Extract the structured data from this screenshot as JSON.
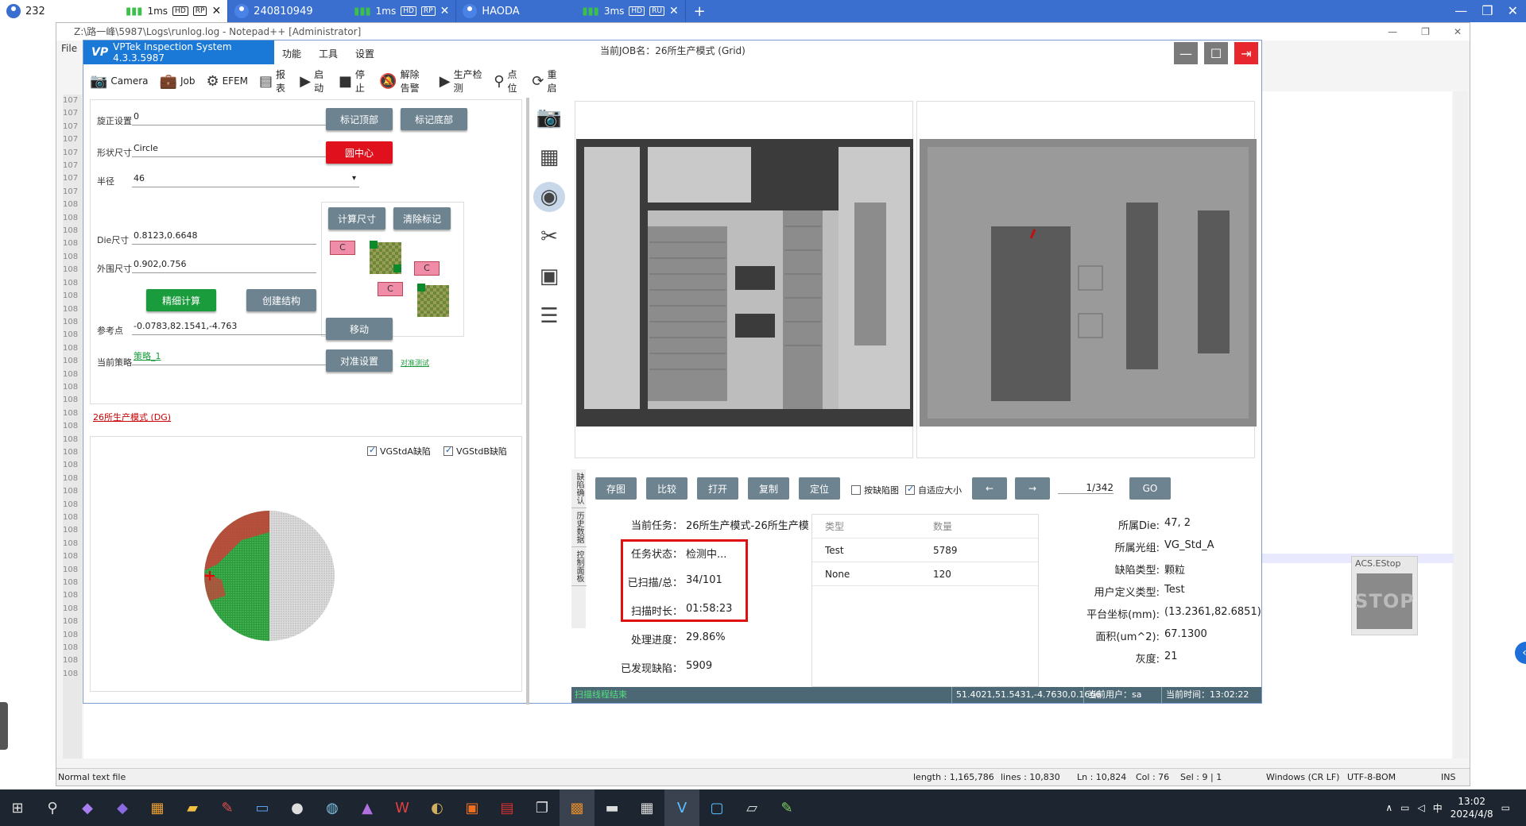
{
  "remote_tabs": [
    {
      "name": "232",
      "signal": "1ms",
      "badge1": "HD",
      "badge2": "RP",
      "active": true
    },
    {
      "name": "240810949",
      "signal": "1ms",
      "badge1": "HD",
      "badge2": "RP",
      "active": false
    },
    {
      "name": "HAODA",
      "signal": "3ms",
      "badge1": "HD",
      "badge2": "RU",
      "active": false
    }
  ],
  "notepad": {
    "title": "Z:\\路一峰\\5987\\Logs\\runlog.log - Notepad++ [Administrator]",
    "menu": "File",
    "line_numbers": [
      "107",
      "107",
      "107",
      "107",
      "107",
      "107",
      "107",
      "107",
      "108",
      "108",
      "108",
      "108",
      "108",
      "108",
      "108",
      "108",
      "108",
      "108",
      "108",
      "108",
      "108",
      "108",
      "108",
      "108",
      "108",
      "108",
      "108",
      "108",
      "108",
      "108",
      "108",
      "108",
      "108",
      "108",
      "108",
      "108",
      "108",
      "108",
      "108",
      "108",
      "108",
      "108",
      "108",
      "108",
      "108"
    ],
    "status": {
      "file_type": "Normal text file",
      "length": "length : 1,165,786",
      "lines": "lines : 10,830",
      "ln": "Ln : 10,824",
      "col": "Col : 76",
      "sel": "Sel : 9 | 1",
      "eol": "Windows (CR LF)",
      "encoding": "UTF-8-BOM",
      "mode": "INS"
    }
  },
  "app": {
    "title": "VPTek Inspection System 4.3.3.5987",
    "logo": "VP",
    "menu": [
      "功能",
      "工具",
      "设置"
    ],
    "current_job": "当前JOB名：26所生产模式 (Grid)",
    "toolbar": [
      "Camera",
      "Job",
      "EFEM",
      "报表",
      "启动",
      "停止",
      "解除告警",
      "生产检测",
      "点位",
      "重启"
    ]
  },
  "left": {
    "rotation_label": "旋正设置",
    "rotation_value": "0",
    "mark_top": "标记顶部",
    "mark_bottom": "标记底部",
    "shape_label": "形状尺寸",
    "shape_value": "Circle",
    "circle_center": "圆中心",
    "radius_label": "半径",
    "radius_value": "46",
    "calc_size": "计算尺寸",
    "clear_mark": "清除标记",
    "die_label": "Die尺寸",
    "die_value": "0.8123,0.6648",
    "outer_label": "外围尺寸",
    "outer_value": "0.902,0.756",
    "fine_calc": "精细计算",
    "create_struct": "创建结构",
    "ref_label": "参考点",
    "ref_value": "-0.0783,82.1541,-4.763",
    "move": "移动",
    "strategy_label": "当前策略",
    "strategy_value": "策略_1",
    "align_setting": "对准设置",
    "align_test": "对准测试",
    "diagram_label": "C",
    "dg_link": "26所生产模式 (DG)",
    "chk_a": "VGStdA缺陷",
    "chk_b": "VGStdB缺陷"
  },
  "actions": {
    "save_img": "存图",
    "compare": "比较",
    "open": "打开",
    "copy": "复制",
    "locate": "定位",
    "defect_img": "按缺陷图",
    "auto_fit": "自适应大小",
    "prev": "←",
    "next": "→",
    "page": "1/342",
    "go": "GO"
  },
  "vtabs": [
    "缺陷确认",
    "历史数据",
    "控制面板"
  ],
  "task": {
    "current_task_label": "当前任务：",
    "current_task_value": "26所生产模式-26所生产模式",
    "status_label": "任务状态：",
    "status_value": "检测中...",
    "scanned_label": "已扫描/总：",
    "scanned_value": "34/101",
    "time_label": "扫描时长：",
    "time_value": "01:58:23",
    "progress_label": "处理进度：",
    "progress_value": "29.86%",
    "found_label": "已发现缺陷：",
    "found_value": "5909"
  },
  "defect_table": {
    "headers": [
      "类型",
      "数量"
    ],
    "rows": [
      [
        "Test",
        "5789"
      ],
      [
        "None",
        "120"
      ]
    ]
  },
  "die_info": {
    "die_label": "所属Die:",
    "die_value": "47, 2",
    "optic_label": "所属光组:",
    "optic_value": "VG_Std_A",
    "type_label": "缺陷类型:",
    "type_value": "颗粒",
    "user_type_label": "用户定义类型:",
    "user_type_value": "Test",
    "coord_label": "平台坐标(mm):",
    "coord_value": "(13.2361,82.6851)",
    "area_label": "面积(um^2):",
    "area_value": "67.1300",
    "gray_label": "灰度:",
    "gray_value": "21"
  },
  "statusbar": {
    "left": "扫描线程结束",
    "coords": "51.4021,51.5431,-4.7630,0.1666",
    "user": "当前用户：sa",
    "time": "当前时间：13:02:22"
  },
  "estop": {
    "title": "ACS.EStop",
    "label": "STOP"
  },
  "taskbar": {
    "time": "13:02",
    "date": "2024/4/8",
    "ime": "中"
  }
}
